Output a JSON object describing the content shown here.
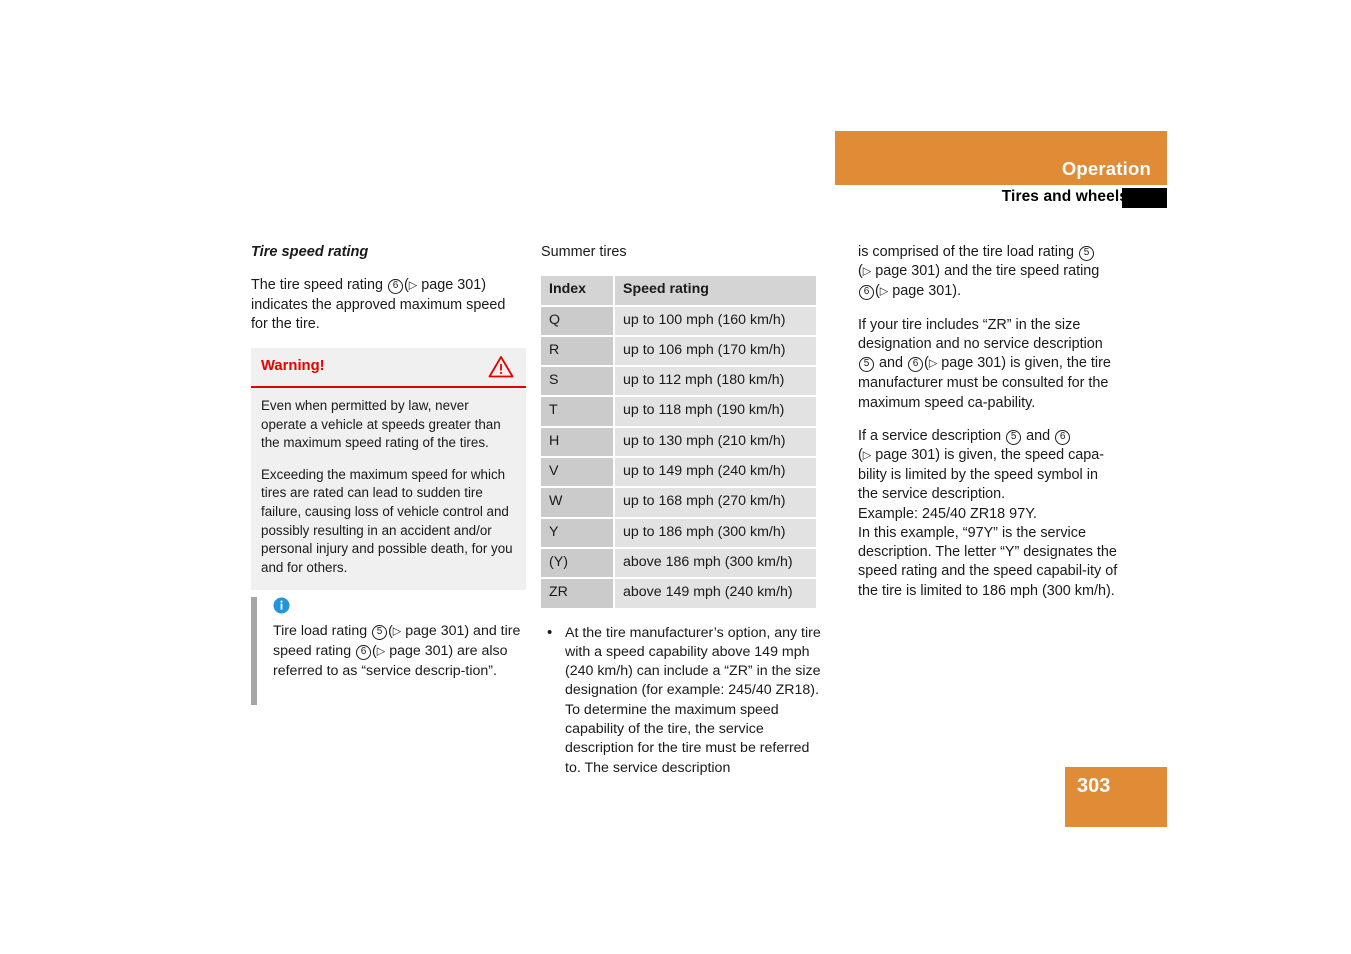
{
  "header": {
    "section": "Operation",
    "subsection": "Tires and wheels",
    "band_color": "#e08b35",
    "tab_color": "#000000"
  },
  "page_number": "303",
  "left_column": {
    "section_title": "Tire speed rating",
    "intro_p1_a": "The tire speed rating",
    "intro_ref1": "6",
    "intro_p1_b": "(",
    "intro_p1_c": "page 301) indicates the approved maximum speed for the tire.",
    "warning": {
      "title": "Warning!",
      "icon": "warning-triangle-icon",
      "accent_color": "#e60000",
      "paragraphs": [
        "Even when permitted by law, never operate a vehicle at speeds greater than the maximum speed rating of the tires.",
        "Exceeding the maximum speed for which tires are rated can lead to sudden tire failure, causing loss of vehicle control and possibly resulting in an accident and/or personal injury and possible death, for you and for others."
      ]
    },
    "note": {
      "icon": "info-circle-icon",
      "icon_color": "#2196dd",
      "text_a": "Tire load rating",
      "ref1": "5",
      "text_b": "(",
      "text_c": "page 301) and tire speed rating",
      "ref2": "6",
      "text_d": "(",
      "text_e": "page 301) are also referred to as “service descrip-tion”."
    }
  },
  "middle_column": {
    "table_caption": "Summer tires",
    "table": {
      "columns": [
        "Index",
        "Speed rating"
      ],
      "rows": [
        [
          "Q",
          "up to 100 mph (160 km/h)"
        ],
        [
          "R",
          "up to 106 mph (170 km/h)"
        ],
        [
          "S",
          "up to 112 mph (180 km/h)"
        ],
        [
          "T",
          "up to 118 mph (190 km/h)"
        ],
        [
          "H",
          "up to 130 mph (210 km/h)"
        ],
        [
          "V",
          "up to 149 mph (240 km/h)"
        ],
        [
          "W",
          "up to 168 mph (270 km/h)"
        ],
        [
          "Y",
          "up to 186 mph (300 km/h)"
        ],
        [
          "(Y)",
          "above 186 mph (300 km/h)"
        ],
        [
          "ZR",
          "above 149 mph (240 km/h)"
        ]
      ]
    },
    "bullets": [
      "At the tire manufacturer’s option, any tire with a speed capability above 149 mph (240 km/h) can include a “ZR” in the size designation (for example: 245/40 ZR18). To determine the maximum speed capability of the tire, the service description for the tire must be referred to. The service description"
    ]
  },
  "right_column": {
    "p1_a": "is comprised of the tire load rating",
    "p1_ref1": "5",
    "p1_b": "(",
    "p1_c": "page 301) and the tire speed rating",
    "p1_ref2": "6",
    "p1_d": "(",
    "p1_e": "page 301).",
    "p2_a": "If your tire includes “ZR” in the size designation and no service description",
    "p2_ref1": "5",
    "p2_b": "and",
    "p2_ref2": "6",
    "p2_c": "(",
    "p2_d": "page 301) is given, the tire manufacturer must be consulted for the maximum speed ca-pability.",
    "p3_a": "If a service description",
    "p3_ref1": "5",
    "p3_b": "and",
    "p3_ref2": "6",
    "p3_c": "(",
    "p3_d": "page 301) is given, the speed capa-bility is limited by the speed symbol in the service description.",
    "p3_e": "Example: 245/40 ZR18 97Y.",
    "p3_f": "In this example, “97Y” is the service description. The letter “Y” designates the speed rating and the speed capabil-ity of the tire is limited to 186 mph (300 km/h)."
  }
}
